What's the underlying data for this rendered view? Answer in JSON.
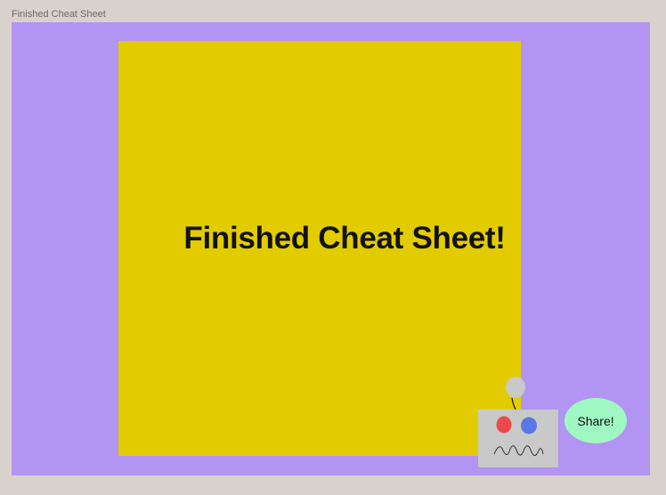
{
  "frame": {
    "label": "Finished Cheat Sheet"
  },
  "card": {
    "title": "Finished Cheat Sheet!"
  },
  "share_button": {
    "label": "Share!"
  },
  "colors": {
    "background": "#d9d1cc",
    "frame_fill": "#b294f2",
    "card_fill": "#e2cc00",
    "share_fill": "#9ff7c2",
    "robot_body": "#c9c9c9",
    "robot_eye_left": "#ec4a4a",
    "robot_eye_right": "#5b78e8"
  },
  "icons": {
    "mascot": "robot-icon"
  }
}
